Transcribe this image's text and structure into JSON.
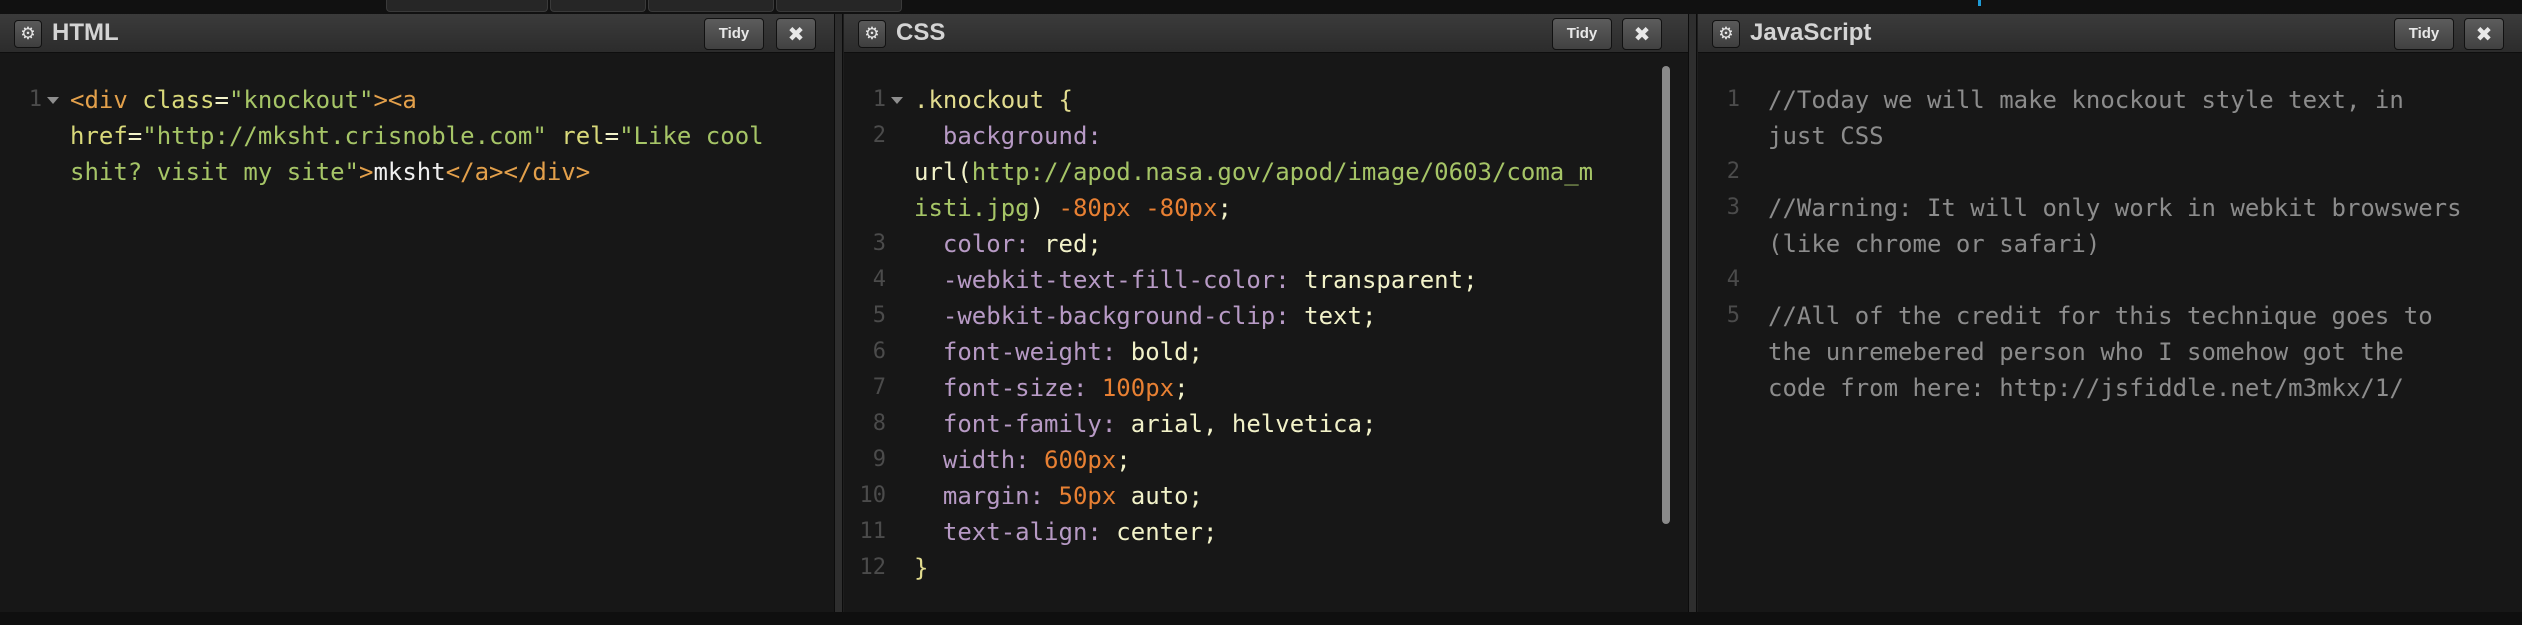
{
  "panels": {
    "html": {
      "title": "HTML",
      "tidy_label": "Tidy",
      "close_label": "✖",
      "lines": [
        {
          "n": "1",
          "tokens": [
            {
              "c": "t-tag",
              "t": "<div "
            },
            {
              "c": "t-attr",
              "t": "class"
            },
            {
              "c": "t-val",
              "t": "="
            },
            {
              "c": "t-str",
              "t": "\"knockout\""
            },
            {
              "c": "t-tag",
              "t": "><a"
            }
          ]
        },
        {
          "n": "",
          "tokens": [
            {
              "c": "t-attr",
              "t": "href"
            },
            {
              "c": "t-val",
              "t": "="
            },
            {
              "c": "t-str",
              "t": "\"http://mksht.crisnoble.com\""
            },
            {
              "c": "t-val",
              "t": " "
            },
            {
              "c": "t-attr",
              "t": "rel"
            },
            {
              "c": "t-val",
              "t": "="
            },
            {
              "c": "t-str",
              "t": "\"Like cool"
            }
          ]
        },
        {
          "n": "",
          "tokens": [
            {
              "c": "t-str",
              "t": "shit? visit my site\""
            },
            {
              "c": "t-tag",
              "t": ">"
            },
            {
              "c": "t-txt",
              "t": "mksht"
            },
            {
              "c": "t-tag",
              "t": "</a></div>"
            }
          ]
        }
      ]
    },
    "css": {
      "title": "CSS",
      "tidy_label": "Tidy",
      "close_label": "✖",
      "lines": [
        {
          "n": "1",
          "tokens": [
            {
              "c": "t-sel",
              "t": ".knockout {"
            }
          ]
        },
        {
          "n": "2",
          "tokens": [
            {
              "c": "t-prop",
              "t": "  background:"
            }
          ]
        },
        {
          "n": "",
          "tokens": [
            {
              "c": "t-val",
              "t": "url("
            },
            {
              "c": "t-url",
              "t": "http://apod.nasa.gov/apod/image/0603/coma_m"
            }
          ]
        },
        {
          "n": "",
          "tokens": [
            {
              "c": "t-url",
              "t": "isti.jpg"
            },
            {
              "c": "t-val",
              "t": ") "
            },
            {
              "c": "t-num",
              "t": "-80px"
            },
            {
              "c": "t-val",
              "t": " "
            },
            {
              "c": "t-num",
              "t": "-80px"
            },
            {
              "c": "t-val",
              "t": ";"
            }
          ]
        },
        {
          "n": "3",
          "tokens": [
            {
              "c": "t-prop",
              "t": "  color: "
            },
            {
              "c": "t-val",
              "t": "red"
            },
            {
              "c": "t-val",
              "t": ";"
            }
          ]
        },
        {
          "n": "4",
          "tokens": [
            {
              "c": "t-prop",
              "t": "  -webkit-text-fill-color: "
            },
            {
              "c": "t-val",
              "t": "transparent"
            },
            {
              "c": "t-val",
              "t": ";"
            }
          ]
        },
        {
          "n": "5",
          "tokens": [
            {
              "c": "t-prop",
              "t": "  -webkit-background-clip: "
            },
            {
              "c": "t-val",
              "t": "text"
            },
            {
              "c": "t-val",
              "t": ";"
            }
          ]
        },
        {
          "n": "6",
          "tokens": [
            {
              "c": "t-prop",
              "t": "  font-weight: "
            },
            {
              "c": "t-val",
              "t": "bold"
            },
            {
              "c": "t-val",
              "t": ";"
            }
          ]
        },
        {
          "n": "7",
          "tokens": [
            {
              "c": "t-prop",
              "t": "  font-size: "
            },
            {
              "c": "t-num",
              "t": "100px"
            },
            {
              "c": "t-val",
              "t": ";"
            }
          ]
        },
        {
          "n": "8",
          "tokens": [
            {
              "c": "t-prop",
              "t": "  font-family: "
            },
            {
              "c": "t-val",
              "t": "arial, helvetica"
            },
            {
              "c": "t-val",
              "t": ";"
            }
          ]
        },
        {
          "n": "9",
          "tokens": [
            {
              "c": "t-prop",
              "t": "  width: "
            },
            {
              "c": "t-num",
              "t": "600px"
            },
            {
              "c": "t-val",
              "t": ";"
            }
          ]
        },
        {
          "n": "10",
          "tokens": [
            {
              "c": "t-prop",
              "t": "  margin: "
            },
            {
              "c": "t-num",
              "t": "50px"
            },
            {
              "c": "t-val",
              "t": " auto;"
            }
          ]
        },
        {
          "n": "11",
          "tokens": [
            {
              "c": "t-prop",
              "t": "  text-align: "
            },
            {
              "c": "t-val",
              "t": "center"
            },
            {
              "c": "t-val",
              "t": ";"
            }
          ]
        },
        {
          "n": "12",
          "tokens": [
            {
              "c": "t-sel",
              "t": "}"
            }
          ]
        }
      ]
    },
    "js": {
      "title": "JavaScript",
      "tidy_label": "Tidy",
      "close_label": "✖",
      "lines": [
        {
          "n": "1",
          "tokens": [
            {
              "c": "t-cmt",
              "t": "//Today we will make knockout style text, in"
            }
          ]
        },
        {
          "n": "",
          "tokens": [
            {
              "c": "t-cmt",
              "t": "just CSS"
            }
          ]
        },
        {
          "n": "2",
          "tokens": []
        },
        {
          "n": "3",
          "tokens": [
            {
              "c": "t-cmt",
              "t": "//Warning: It will only work in webkit browswers"
            }
          ]
        },
        {
          "n": "",
          "tokens": [
            {
              "c": "t-cmt",
              "t": "(like chrome or safari)"
            }
          ]
        },
        {
          "n": "4",
          "tokens": []
        },
        {
          "n": "5",
          "tokens": [
            {
              "c": "t-cmt",
              "t": "//All of the credit for this technique goes to"
            }
          ]
        },
        {
          "n": "",
          "tokens": [
            {
              "c": "t-cmt",
              "t": "the unremebered person who I somehow got the"
            }
          ]
        },
        {
          "n": "",
          "tokens": [
            {
              "c": "t-cmt",
              "t": "code from here: http://jsfiddle.net/m3mkx/1/"
            }
          ]
        }
      ]
    }
  },
  "icons": {
    "settings": "gear-icon",
    "close": "close-icon",
    "fold": "fold-arrow-icon"
  },
  "colors": {
    "background": "#171717",
    "header": "#333333",
    "comment": "#8c8c8c",
    "number": "#e88033",
    "string": "#a6c567"
  }
}
